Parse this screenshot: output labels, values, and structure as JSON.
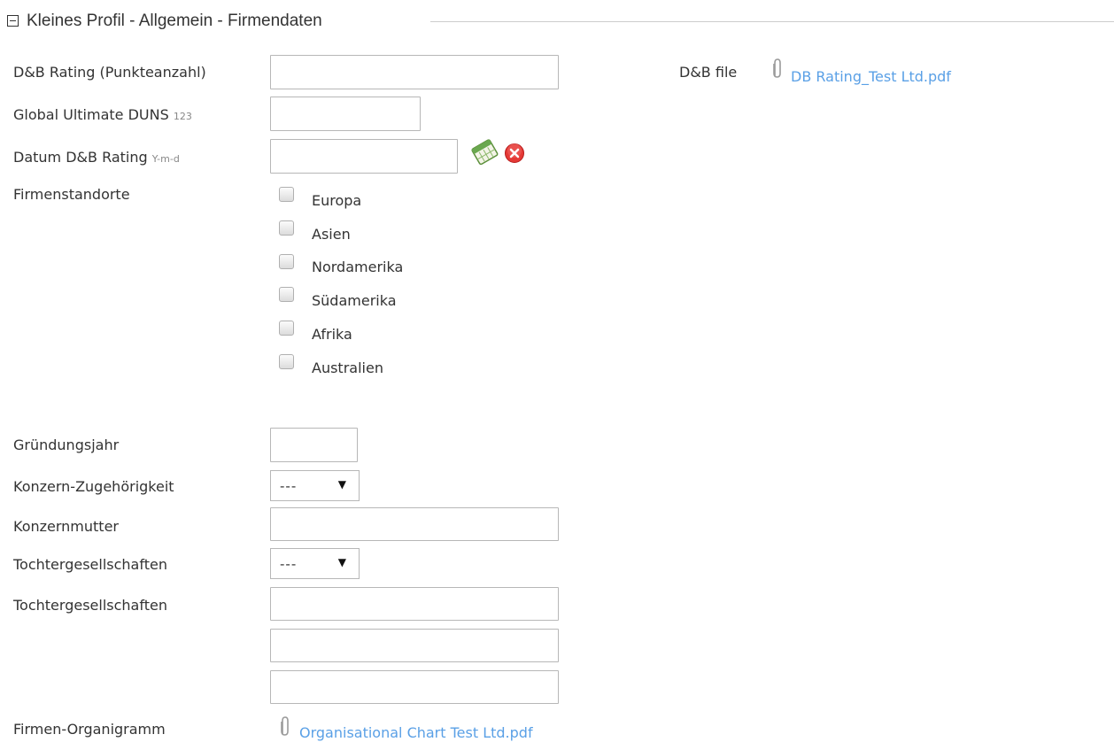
{
  "section": {
    "title": "Kleines Profil - Allgemein - Firmendaten",
    "toggle_icon": "collapse-minus-icon"
  },
  "fields": {
    "dnb_rating": {
      "label": "D&B Rating (Punkteanzahl)",
      "value": ""
    },
    "global_duns": {
      "label": "Global Ultimate DUNS",
      "hint": "123",
      "value": ""
    },
    "datum_rating": {
      "label": "Datum D&B Rating",
      "hint": "Y-m-d",
      "value": ""
    },
    "standorte": {
      "label": "Firmenstandorte",
      "options": [
        "Europa",
        "Asien",
        "Nordamerika",
        "Südamerika",
        "Afrika",
        "Australien"
      ],
      "checked": [
        false,
        false,
        false,
        false,
        false,
        false
      ]
    },
    "gruendungsjahr": {
      "label": "Gründungsjahr",
      "value": ""
    },
    "konzern_zugehoerigkeit": {
      "label": "Konzern-Zugehörigkeit",
      "selected": "---"
    },
    "konzernmutter": {
      "label": "Konzernmutter",
      "value": ""
    },
    "tochter_select": {
      "label": "Tochtergesellschaften",
      "selected": "---"
    },
    "tochter_text": {
      "label": "Tochtergesellschaften",
      "values": [
        "",
        "",
        ""
      ]
    },
    "organigramm": {
      "label": "Firmen-Organigramm",
      "file": "Organisational Chart Test Ltd.pdf"
    }
  },
  "dnb_file": {
    "label": "D&B file",
    "file": "DB Rating_Test Ltd.pdf"
  },
  "icons": {
    "calendar": "calendar-icon",
    "clear": "clear-date-icon",
    "attachment": "paperclip-icon",
    "dropdown": "dropdown-arrow-icon"
  },
  "colors": {
    "link": "#5aa0e6",
    "clear_red": "#e53935",
    "calendar_green": "#6aa84f"
  }
}
